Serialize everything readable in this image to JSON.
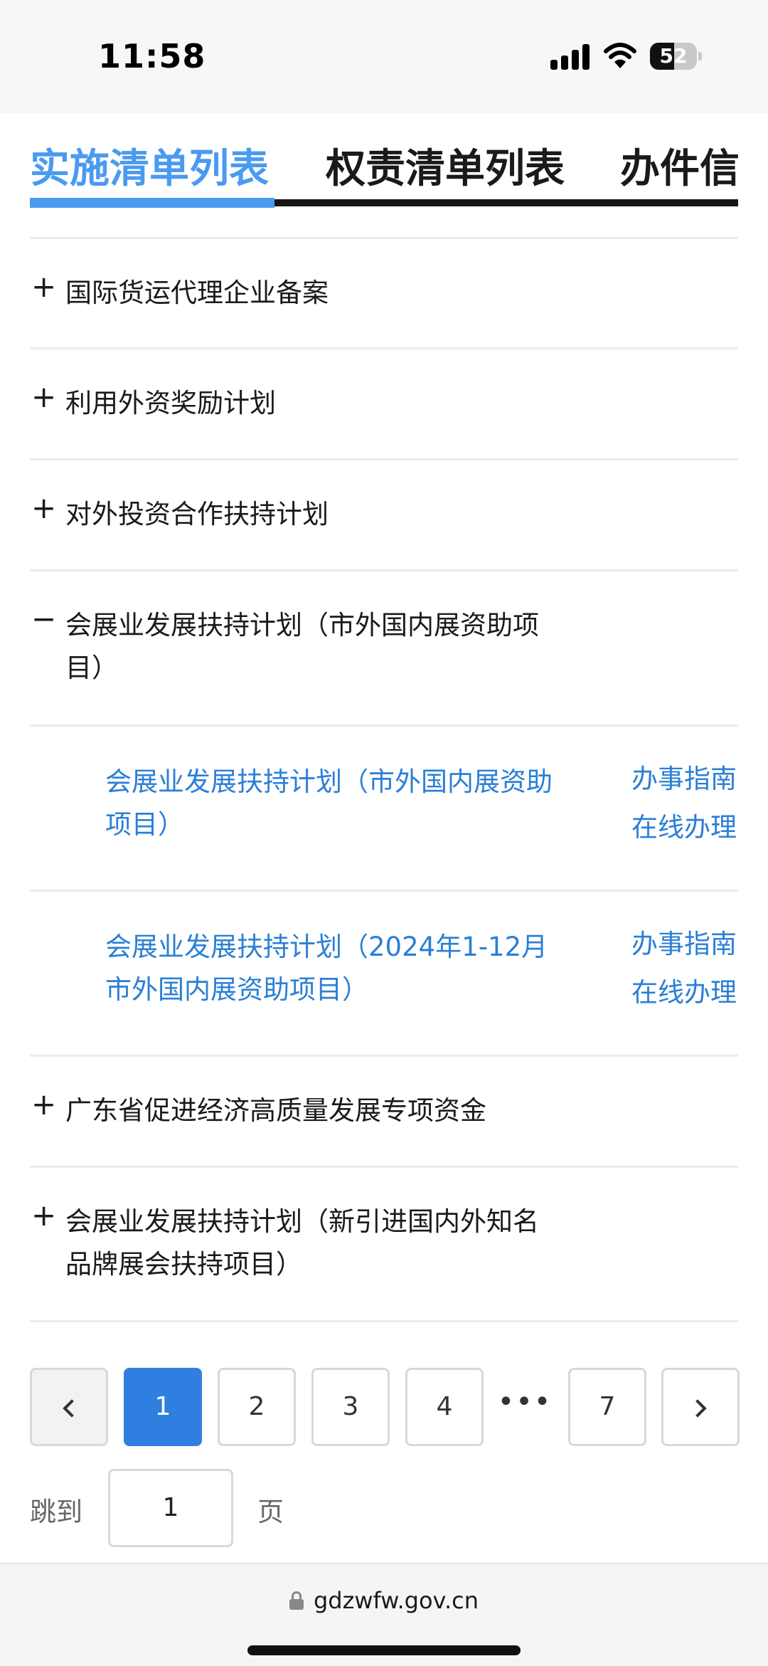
{
  "status_bar": {
    "time": "11:58",
    "battery_level": "52",
    "battery_display": "5"
  },
  "tabs": [
    {
      "label": "实施清单列表",
      "active": true
    },
    {
      "label": "权责清单列表",
      "active": false
    },
    {
      "label": "办件信",
      "active": false
    }
  ],
  "list": {
    "items": [
      {
        "sign": "+",
        "label": "国际货运代理企业备案"
      },
      {
        "sign": "+",
        "label": "利用外资奖励计划"
      },
      {
        "sign": "+",
        "label": "对外投资合作扶持计划"
      },
      {
        "sign": "−",
        "label": "会展业发展扶持计划（市外国内展资助项目）"
      },
      {
        "sign": "+",
        "label": "广东省促进经济高质量发展专项资金"
      },
      {
        "sign": "+",
        "label": "会展业发展扶持计划（新引进国内外知名品牌展会扶持项目）"
      }
    ],
    "sub_items": [
      {
        "label": "会展业发展扶持计划（市外国内展资助项目）",
        "guide": "办事指南",
        "online": "在线办理"
      },
      {
        "label": "会展业发展扶持计划（2024年1-12月市外国内展资助项目）",
        "guide": "办事指南",
        "online": "在线办理"
      }
    ]
  },
  "pagination": {
    "pages": [
      "1",
      "2",
      "3",
      "4",
      "7"
    ],
    "current": "1",
    "ellipsis": "•••",
    "jump_prefix": "跳到",
    "jump_value": "1",
    "jump_suffix": "页"
  },
  "browser": {
    "url": "gdzwfw.gov.cn"
  }
}
